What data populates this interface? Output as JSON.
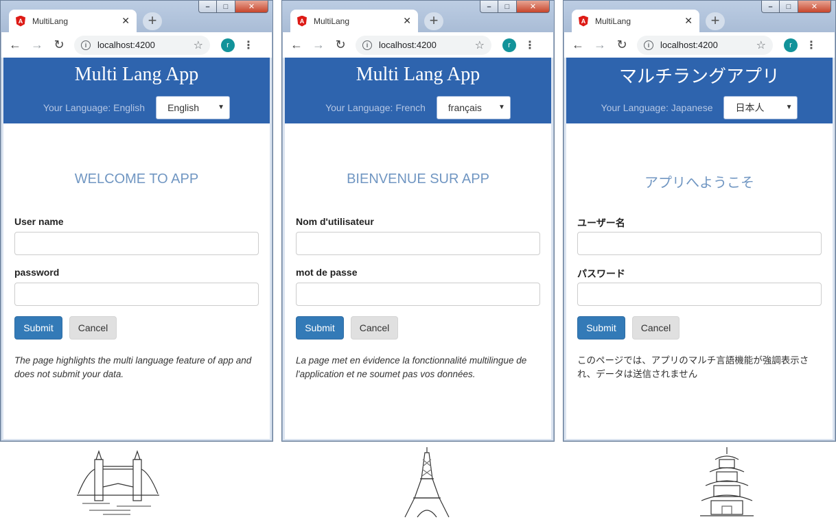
{
  "windows": [
    {
      "tab_title": "MultiLang",
      "url": "localhost:4200",
      "profile_initial": "r",
      "app_title": "Multi Lang App",
      "language_label": "Your Language: English",
      "language_selected": "English",
      "welcome": "WELCOME TO APP",
      "username_label": "User name",
      "password_label": "password",
      "submit_label": "Submit",
      "cancel_label": "Cancel",
      "note": "The page highlights the multi language feature of app and does not submit your data."
    },
    {
      "tab_title": "MultiLang",
      "url": "localhost:4200",
      "profile_initial": "r",
      "app_title": "Multi Lang App",
      "language_label": "Your Language: French",
      "language_selected": "français",
      "welcome": "BIENVENUE SUR APP",
      "username_label": "Nom d'utilisateur",
      "password_label": "mot de passe",
      "submit_label": "Submit",
      "cancel_label": "Cancel",
      "note": "La page met en évidence la fonctionnalité multilingue de l'application et ne soumet pas vos données."
    },
    {
      "tab_title": "MultiLang",
      "url": "localhost:4200",
      "profile_initial": "r",
      "app_title": "マルチラングアプリ",
      "language_label": "Your Language: Japanese",
      "language_selected": "日本人",
      "welcome": "アプリへようこそ",
      "username_label": "ユーザー名",
      "password_label": "パスワード",
      "submit_label": "Submit",
      "cancel_label": "Cancel",
      "note": "このページでは、アプリのマルチ言語機能が強調表示され、データは送信されません"
    }
  ],
  "landmarks": [
    "tower-bridge-icon",
    "eiffel-tower-icon",
    "pagoda-icon"
  ],
  "colors": {
    "header_blue": "#2e64ae",
    "primary_button": "#337ab7",
    "welcome_text": "#7096c2"
  }
}
